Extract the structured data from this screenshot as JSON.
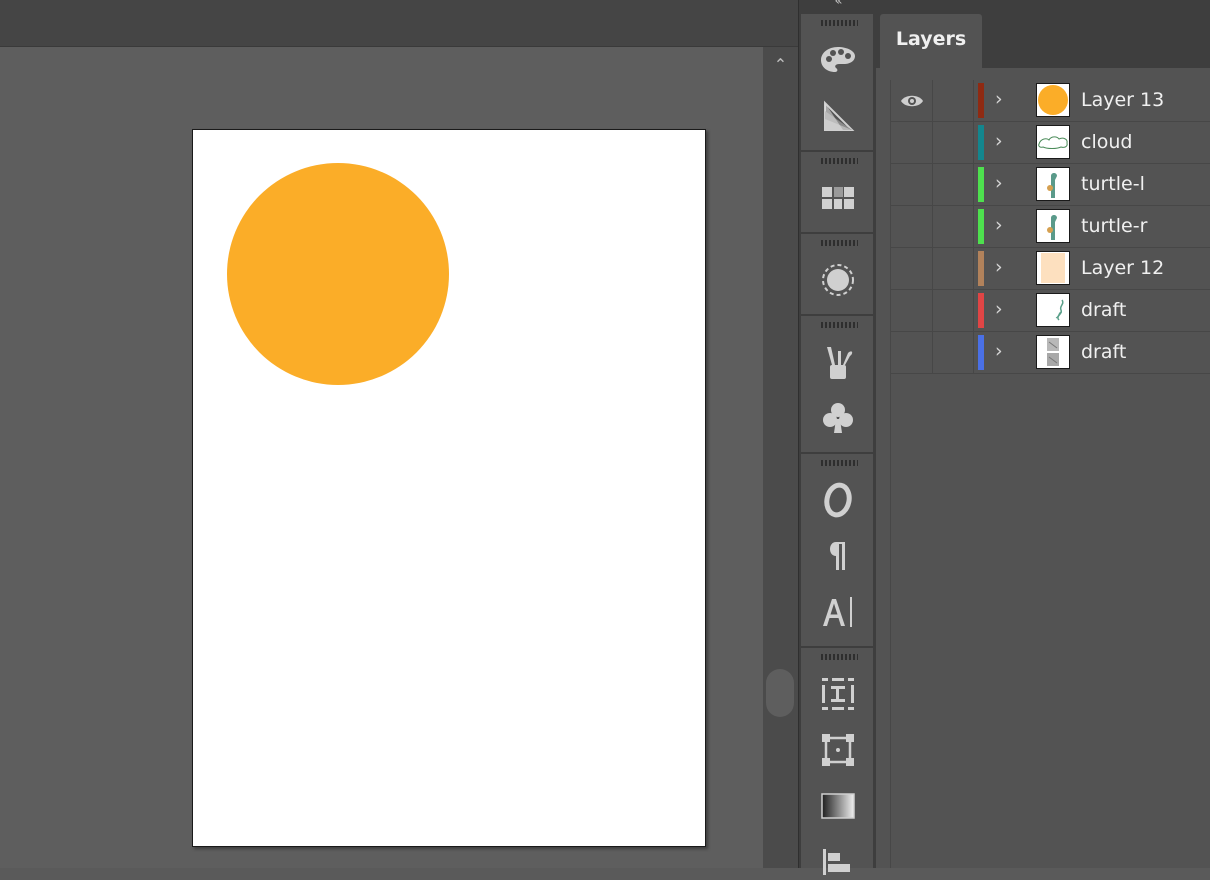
{
  "panel": {
    "tab_label": "Layers",
    "layers": [
      {
        "name": "Layer 13",
        "color": "#8f2a12",
        "thumb": "orange-circle",
        "visible": true
      },
      {
        "name": "cloud",
        "color": "#13868e",
        "thumb": "cloud-sketch",
        "visible": false
      },
      {
        "name": "turtle-l",
        "color": "#4ee04e",
        "thumb": "turtle-figure",
        "visible": false
      },
      {
        "name": "turtle-r",
        "color": "#4ee04e",
        "thumb": "turtle-figure",
        "visible": false
      },
      {
        "name": "Layer 12",
        "color": "#b2825b",
        "thumb": "peach-fill",
        "visible": false
      },
      {
        "name": "draft",
        "color": "#e04545",
        "thumb": "green-sketch",
        "visible": false
      },
      {
        "name": "draft",
        "color": "#4a70e6",
        "thumb": "grey-draft",
        "visible": false
      }
    ]
  },
  "canvas": {
    "circle_color": "#fbad28",
    "artboard_color": "#ffffff"
  },
  "toolbar": {
    "icons": [
      "color-palette-icon",
      "swatch-fan-icon",
      "swatches-grid-icon",
      "stroke-circle-icon",
      "brushes-icon",
      "symbols-club-icon",
      "opentype-glyph-icon",
      "paragraph-icon",
      "character-icon",
      "transform-icon",
      "artboard-icon",
      "gradient-icon",
      "align-icon"
    ]
  }
}
